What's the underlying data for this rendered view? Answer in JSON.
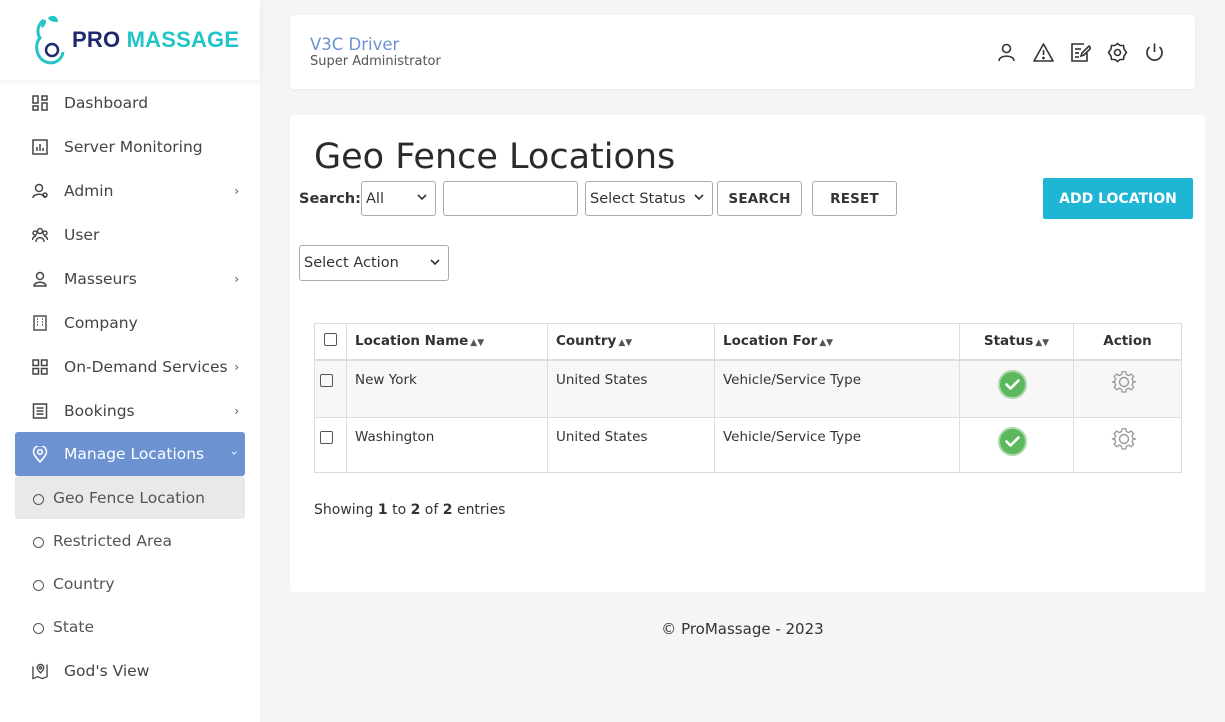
{
  "brand": {
    "pro": "PRO",
    "massage": "MASSAGE"
  },
  "sidebar": {
    "items": [
      {
        "label": "Dashboard",
        "icon": "dashboard-icon"
      },
      {
        "label": "Server Monitoring",
        "icon": "chart-icon"
      },
      {
        "label": "Admin",
        "icon": "admin-icon"
      },
      {
        "label": "User",
        "icon": "users-icon"
      },
      {
        "label": "Masseurs",
        "icon": "person-icon"
      },
      {
        "label": "Company",
        "icon": "building-icon"
      },
      {
        "label": "On-Demand Services",
        "icon": "grid-icon"
      },
      {
        "label": "Bookings",
        "icon": "list-icon"
      },
      {
        "label": "Manage Locations",
        "icon": "location-pin-icon"
      }
    ],
    "subitems": [
      {
        "label": "Geo Fence Location"
      },
      {
        "label": "Restricted Area"
      },
      {
        "label": "Country"
      },
      {
        "label": "State"
      }
    ],
    "gods_view": "God's View"
  },
  "header": {
    "user_name": "V3C Driver",
    "user_role": "Super Administrator"
  },
  "main": {
    "title": "Geo Fence Locations",
    "search_label": "Search:",
    "search_field_selected": "All",
    "status_selected": "Select Status",
    "search_button": "SEARCH",
    "reset_button": "RESET",
    "add_button": "ADD LOCATION",
    "action_selected": "Select Action",
    "columns": [
      "Location Name",
      "Country",
      "Location For",
      "Status",
      "Action"
    ],
    "rows": [
      {
        "name": "New York",
        "country": "United States",
        "location_for": "Vehicle/Service Type"
      },
      {
        "name": "Washington",
        "country": "United States",
        "location_for": "Vehicle/Service Type"
      }
    ],
    "showing": {
      "prefix": "Showing ",
      "from": "1",
      "to_word": " to ",
      "to": "2",
      "of_word": " of ",
      "total": "2",
      "suffix": " entries"
    }
  },
  "footer": "© ProMassage - 2023",
  "colors": {
    "accent": "#6c92d2",
    "primary_button": "#1fb5d4",
    "status_active": "#5cb85c"
  }
}
